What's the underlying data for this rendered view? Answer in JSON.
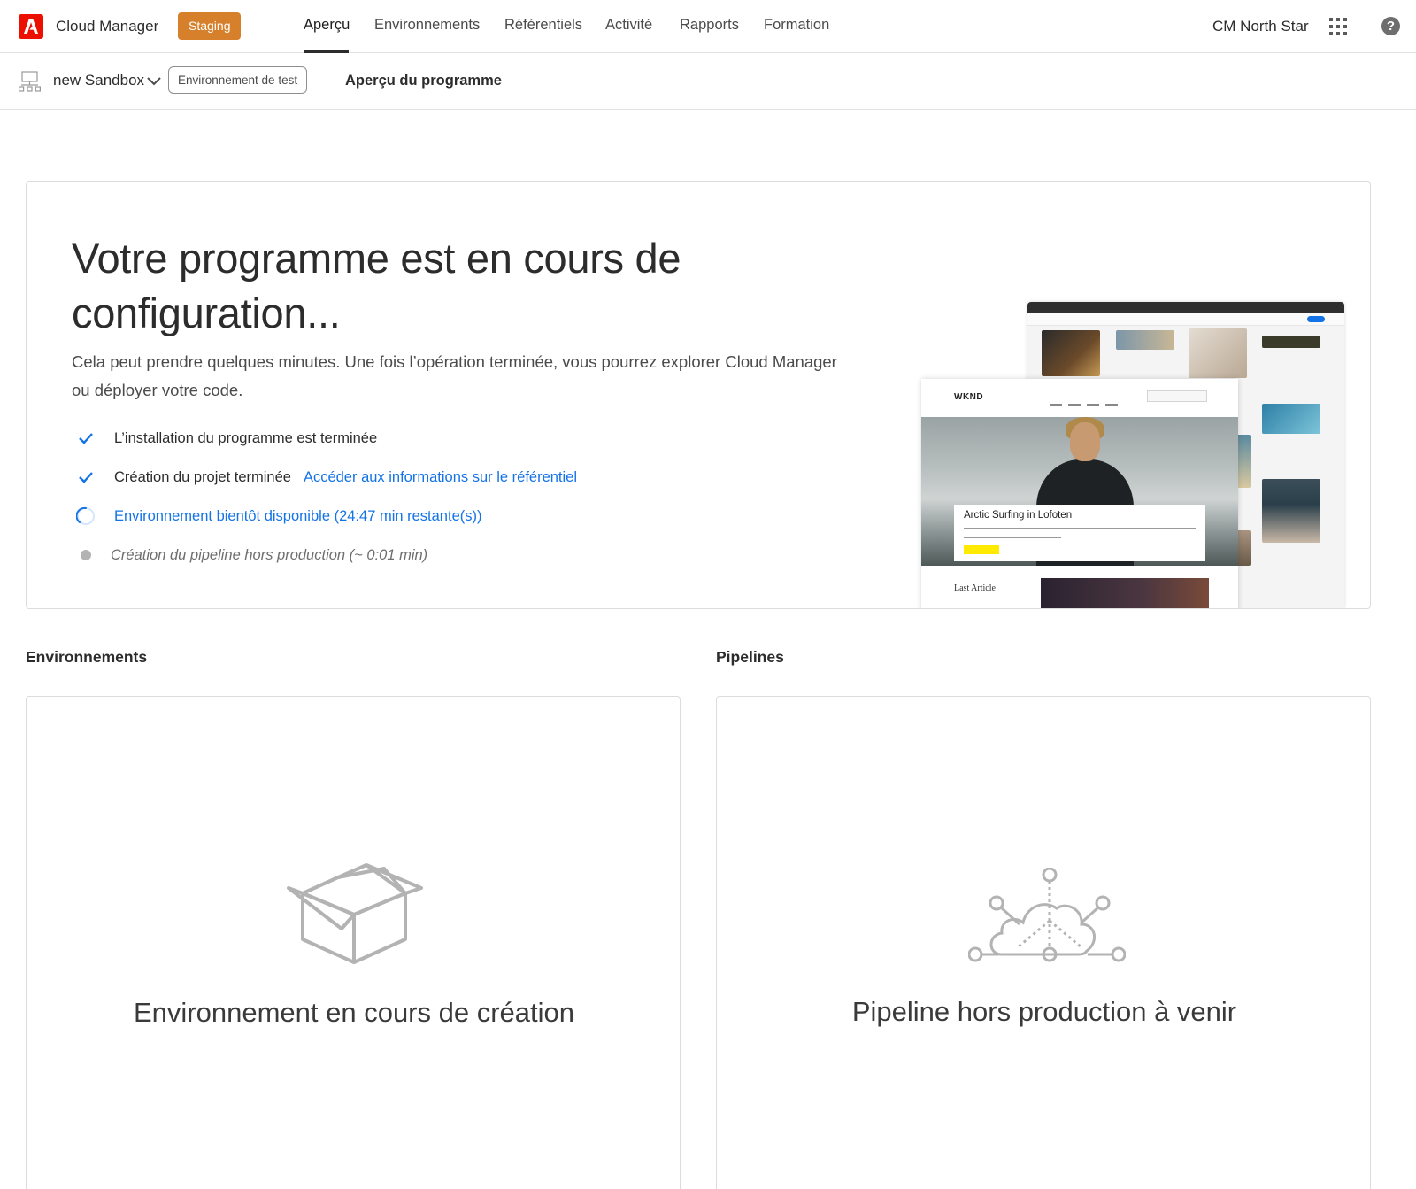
{
  "header": {
    "app_title": "Cloud Manager",
    "badge": "Staging",
    "nav": [
      {
        "label": "Aperçu",
        "active": true
      },
      {
        "label": "Environnements",
        "active": false
      },
      {
        "label": "Référentiels",
        "active": false
      },
      {
        "label": "Activité",
        "active": false
      },
      {
        "label": "Rapports",
        "active": false
      },
      {
        "label": "Formation",
        "active": false
      }
    ],
    "org_name": "CM North Star",
    "apps_icon": "apps-grid-icon",
    "help_icon": "help-icon",
    "help_glyph": "?"
  },
  "subbar": {
    "program_name": "new Sandbox",
    "env_tag": "Environnement de test",
    "page_title": "Aperçu du programme"
  },
  "hero": {
    "title": "Votre programme est en cours de configuration...",
    "description": "Cela peut prendre quelques minutes. Une fois l’opération terminée, vous pourrez explorer Cloud Manager ou déployer votre code.",
    "steps": [
      {
        "status": "done",
        "text": "L’installation du programme est terminée"
      },
      {
        "status": "done",
        "text": "Création du projet terminée",
        "link": "Accéder aux informations sur le référentiel"
      },
      {
        "status": "in-progress",
        "text": "Environnement bientôt disponible (24:47 min restante(s))"
      },
      {
        "status": "pending",
        "text": "Création du pipeline hors production (~ 0:01 min)"
      }
    ],
    "illustration": {
      "site_logo": "WKND",
      "article_title": "Arctic Surfing in Lofoten",
      "last_article": "Last Article"
    }
  },
  "sections": {
    "environments": {
      "title": "Environnements",
      "empty_text": "Environnement en cours de création",
      "icon": "box-icon"
    },
    "pipelines": {
      "title": "Pipelines",
      "empty_text": "Pipeline hors production à venir",
      "icon": "cloud-network-icon"
    }
  },
  "colors": {
    "accent": "#1473e6",
    "brand": "#eb1000",
    "staging": "#d7802c"
  }
}
